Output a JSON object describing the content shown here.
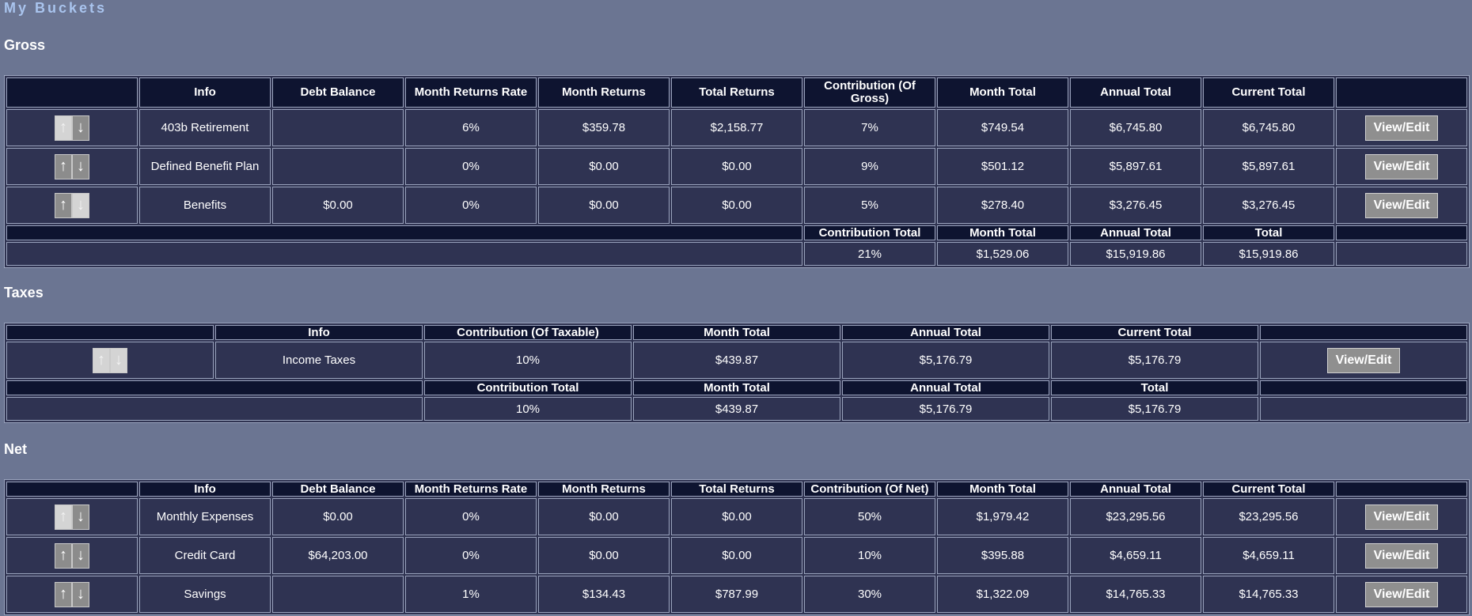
{
  "app_title": "My Buckets",
  "gross": {
    "title": "Gross",
    "headers": [
      "",
      "Info",
      "Debt Balance",
      "Month Returns Rate",
      "Month Returns",
      "Total Returns",
      "Contribution (Of Gross)",
      "Month Total",
      "Annual Total",
      "Current Total",
      ""
    ],
    "rows": [
      {
        "info": "403b Retirement",
        "debt": "",
        "rate": "6%",
        "month_returns": "$359.78",
        "total_returns": "$2,158.77",
        "contribution": "7%",
        "month_total": "$749.54",
        "annual_total": "$6,745.80",
        "current_total": "$6,745.80",
        "up_enabled": false,
        "down_enabled": true
      },
      {
        "info": "Defined Benefit Plan",
        "debt": "",
        "rate": "0%",
        "month_returns": "$0.00",
        "total_returns": "$0.00",
        "contribution": "9%",
        "month_total": "$501.12",
        "annual_total": "$5,897.61",
        "current_total": "$5,897.61",
        "up_enabled": true,
        "down_enabled": true
      },
      {
        "info": "Benefits",
        "debt": "$0.00",
        "rate": "0%",
        "month_returns": "$0.00",
        "total_returns": "$0.00",
        "contribution": "5%",
        "month_total": "$278.40",
        "annual_total": "$3,276.45",
        "current_total": "$3,276.45",
        "up_enabled": true,
        "down_enabled": false
      }
    ],
    "summary_headers": [
      "Contribution Total",
      "Month Total",
      "Annual Total",
      "Total"
    ],
    "summary": {
      "contribution": "21%",
      "month_total": "$1,529.06",
      "annual_total": "$15,919.86",
      "total": "$15,919.86"
    }
  },
  "taxes": {
    "title": "Taxes",
    "headers": [
      "",
      "Info",
      "Contribution (Of Taxable)",
      "Month Total",
      "Annual Total",
      "Current Total",
      ""
    ],
    "rows": [
      {
        "info": "Income Taxes",
        "contribution": "10%",
        "month_total": "$439.87",
        "annual_total": "$5,176.79",
        "current_total": "$5,176.79",
        "up_enabled": false,
        "down_enabled": false
      }
    ],
    "summary_headers": [
      "Contribution Total",
      "Month Total",
      "Annual Total",
      "Total"
    ],
    "summary": {
      "contribution": "10%",
      "month_total": "$439.87",
      "annual_total": "$5,176.79",
      "total": "$5,176.79"
    }
  },
  "net": {
    "title": "Net",
    "headers": [
      "",
      "Info",
      "Debt Balance",
      "Month Returns Rate",
      "Month Returns",
      "Total Returns",
      "Contribution (Of Net)",
      "Month Total",
      "Annual Total",
      "Current Total",
      ""
    ],
    "rows": [
      {
        "info": "Monthly Expenses",
        "debt": "$0.00",
        "rate": "0%",
        "month_returns": "$0.00",
        "total_returns": "$0.00",
        "contribution": "50%",
        "month_total": "$1,979.42",
        "annual_total": "$23,295.56",
        "current_total": "$23,295.56",
        "up_enabled": false,
        "down_enabled": true
      },
      {
        "info": "Credit Card",
        "debt": "$64,203.00",
        "rate": "0%",
        "month_returns": "$0.00",
        "total_returns": "$0.00",
        "contribution": "10%",
        "month_total": "$395.88",
        "annual_total": "$4,659.11",
        "current_total": "$4,659.11",
        "up_enabled": true,
        "down_enabled": true
      },
      {
        "info": "Savings",
        "debt": "",
        "rate": "1%",
        "month_returns": "$134.43",
        "total_returns": "$787.99",
        "contribution": "30%",
        "month_total": "$1,322.09",
        "annual_total": "$14,765.33",
        "current_total": "$14,765.33",
        "up_enabled": true,
        "down_enabled": true
      }
    ]
  },
  "labels": {
    "view_edit": "View/Edit",
    "up_arrow": "↑",
    "down_arrow": "↓"
  }
}
